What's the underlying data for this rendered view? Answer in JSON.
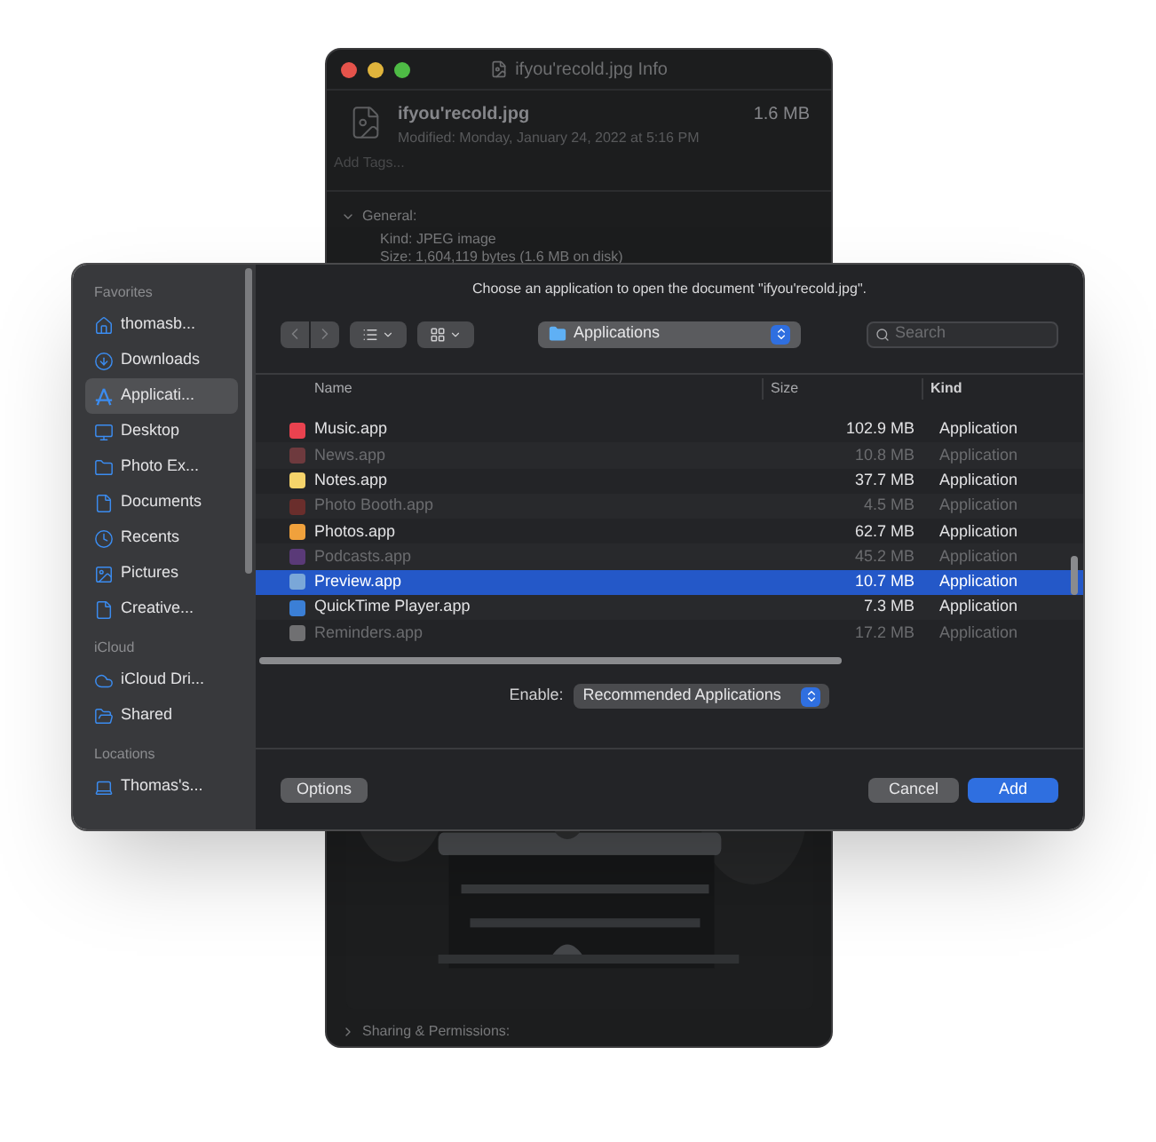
{
  "info_window": {
    "title": "ifyou'recold.jpg Info",
    "file_name": "ifyou'recold.jpg",
    "file_size": "1.6 MB",
    "modified": "Modified: Monday, January 24, 2022 at 5:16 PM",
    "tags": {
      "placeholder": "Add Tags..."
    },
    "general": {
      "label": "General:",
      "expanded": true,
      "lines": [
        "Kind: JPEG image",
        "Size: 1,604,119 bytes (1.6 MB on disk)"
      ]
    },
    "sharing": {
      "label": "Sharing & Permissions:",
      "expanded": false
    }
  },
  "sidebar": {
    "sections": [
      {
        "title": "Favorites",
        "items": [
          {
            "label": "thomasb...",
            "kind": "home",
            "selected": false
          },
          {
            "label": "Downloads",
            "kind": "download",
            "selected": false
          },
          {
            "label": "Applicati...",
            "kind": "apps",
            "selected": true
          },
          {
            "label": "Desktop",
            "kind": "desktop",
            "selected": false
          },
          {
            "label": "Photo Ex...",
            "kind": "folder",
            "selected": false
          },
          {
            "label": "Documents",
            "kind": "document",
            "selected": false
          },
          {
            "label": "Recents",
            "kind": "clock",
            "selected": false
          },
          {
            "label": "Pictures",
            "kind": "pictures",
            "selected": false
          },
          {
            "label": "Creative...",
            "kind": "document",
            "selected": false
          }
        ]
      },
      {
        "title": "iCloud",
        "items": [
          {
            "label": "iCloud Dri...",
            "kind": "cloud",
            "selected": false
          },
          {
            "label": "Shared",
            "kind": "shared",
            "selected": false
          }
        ]
      },
      {
        "title": "Locations",
        "items": [
          {
            "label": "Thomas's...",
            "kind": "computer",
            "selected": false
          }
        ]
      }
    ]
  },
  "dialog": {
    "prompt": "Choose an application to open the document \"ifyou'recold.jpg\".",
    "location": "Applications",
    "search": {
      "placeholder": "Search"
    },
    "columns": [
      "Name",
      "Size",
      "Kind"
    ],
    "rows": [
      {
        "name": "Music.app",
        "size": "102.9 MB",
        "kind_text": "Application",
        "disabled": false,
        "selected": false,
        "color": "#e9424f"
      },
      {
        "name": "News.app",
        "size": "10.8 MB",
        "kind_text": "Application",
        "disabled": true,
        "selected": false,
        "color": "#6e3a3e"
      },
      {
        "name": "Notes.app",
        "size": "37.7 MB",
        "kind_text": "Application",
        "disabled": false,
        "selected": false,
        "color": "#f5d36a"
      },
      {
        "name": "Photo Booth.app",
        "size": "4.5 MB",
        "kind_text": "Application",
        "disabled": true,
        "selected": false,
        "color": "#6a2e2c"
      },
      {
        "name": "Photos.app",
        "size": "62.7 MB",
        "kind_text": "Application",
        "disabled": false,
        "selected": false,
        "color": "#f0a13c"
      },
      {
        "name": "Podcasts.app",
        "size": "45.2 MB",
        "kind_text": "Application",
        "disabled": true,
        "selected": false,
        "color": "#5a3a78"
      },
      {
        "name": "Preview.app",
        "size": "10.7 MB",
        "kind_text": "Application",
        "disabled": false,
        "selected": true,
        "color": "#7aa7d8"
      },
      {
        "name": "QuickTime Player.app",
        "size": "7.3 MB",
        "kind_text": "Application",
        "disabled": false,
        "selected": false,
        "color": "#3b7fd6"
      },
      {
        "name": "Reminders.app",
        "size": "17.2 MB",
        "kind_text": "Application",
        "disabled": true,
        "selected": false,
        "color": "#707072"
      }
    ],
    "enable_label": "Enable:",
    "enable_value": "Recommended Applications",
    "buttons": {
      "options": "Options",
      "cancel": "Cancel",
      "add": "Add"
    }
  }
}
